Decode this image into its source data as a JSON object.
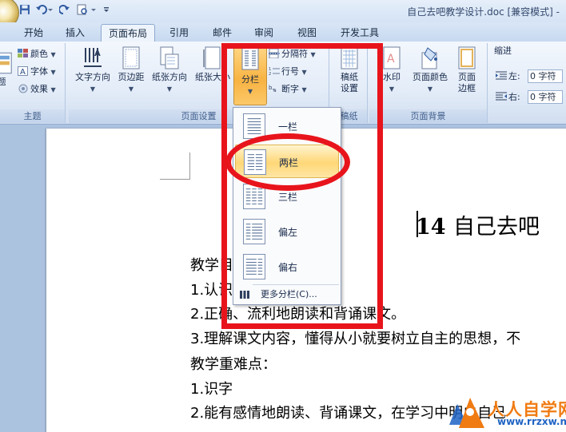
{
  "window": {
    "title": "自己去吧教学设计.doc [兼容模式] -"
  },
  "tabs": [
    {
      "label": "开始"
    },
    {
      "label": "插入"
    },
    {
      "label": "页面布局"
    },
    {
      "label": "引用"
    },
    {
      "label": "邮件"
    },
    {
      "label": "审阅"
    },
    {
      "label": "视图"
    },
    {
      "label": "开发工具"
    }
  ],
  "ribbon": {
    "theme_group": {
      "label": "主题",
      "theme_label": "题",
      "colors": "颜色",
      "fonts": "字体",
      "effects": "效果"
    },
    "page_setup_group": {
      "label": "页面设置",
      "text_direction": "文字方向",
      "margins": "页边距",
      "orientation": "纸张方向",
      "size": "纸张大小",
      "columns": "分栏",
      "breaks": "分隔符",
      "line_numbers": "行号",
      "hyphenation": "断字"
    },
    "draft_group": {
      "label": "稿纸",
      "draft_settings_line1": "稿纸",
      "draft_settings_line2": "设置"
    },
    "page_background_group": {
      "label": "页面背景",
      "watermark": "水印",
      "page_color": "页面颜色",
      "page_borders_line1": "页面",
      "page_borders_line2": "边框"
    },
    "paragraph_group": {
      "indent_label": "缩进",
      "left_label": "左:",
      "left_value": "0 字符",
      "right_label": "右:",
      "right_value": "0 字符"
    }
  },
  "columns_menu": {
    "items": [
      {
        "label": "一栏"
      },
      {
        "label": "两栏"
      },
      {
        "label": "三栏"
      },
      {
        "label": "偏左"
      },
      {
        "label": "偏右"
      }
    ],
    "more": "更多分栏(C)..."
  },
  "document": {
    "title_number": "14",
    "title_text": "自己去吧",
    "lines": [
      "教学目标：",
      "1.认识",
      "2.正确、流利地朗读和背诵课文。",
      "3.理解课文内容，懂得从小就要树立自主的思想，不",
      "教学重难点：",
      "1.识字",
      "2.能有感情地朗读、背诵课文，在学习中明白自己"
    ]
  },
  "watermark": {
    "brand": "人人自学网",
    "url": "www.rrzxw.net"
  },
  "colors": {
    "annotation_red": "#e8141c",
    "menu_highlight": "#ffd777",
    "brand_orange": "#f07b12",
    "brand_blue": "#1f63c4"
  }
}
